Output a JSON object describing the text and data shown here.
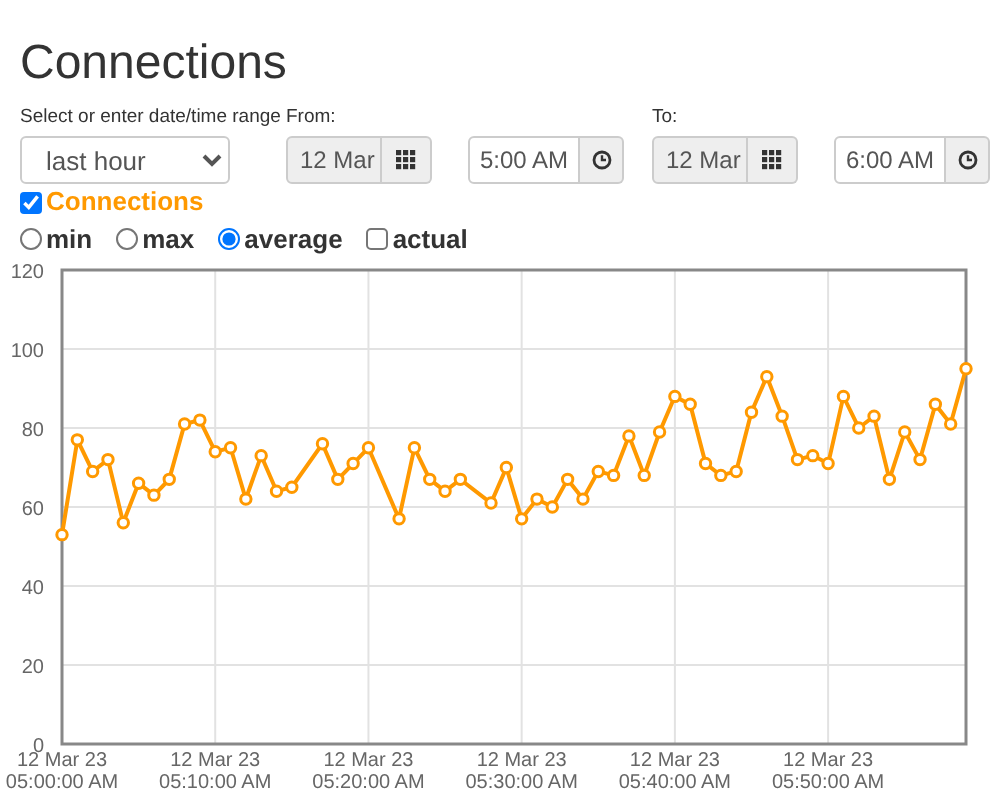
{
  "title": "Connections",
  "range": {
    "label": "Select or enter date/time range",
    "value": "last hour"
  },
  "from": {
    "label": "From:",
    "date": {
      "value": "12 Mar",
      "disabled": true
    },
    "time": {
      "value": "5:00 AM",
      "disabled": false
    }
  },
  "to": {
    "label": "To:",
    "date": {
      "value": "12 Mar",
      "disabled": true
    },
    "time": {
      "value": "6:00 AM",
      "disabled": false
    }
  },
  "series_toggle": {
    "checked": true
  },
  "modes": [
    {
      "kind": "radio",
      "label": "min",
      "selected": false
    },
    {
      "kind": "radio",
      "label": "max",
      "selected": false
    },
    {
      "kind": "radio",
      "label": "average",
      "selected": true
    },
    {
      "kind": "checkbox",
      "label": "actual",
      "checked": false
    }
  ],
  "chart_data": {
    "type": "line",
    "categories": [
      "12 Mar 23\n05:00:00 AM",
      null,
      null,
      null,
      null,
      null,
      null,
      null,
      null,
      null,
      "12 Mar 23\n05:10:00 AM",
      null,
      null,
      null,
      null,
      null,
      null,
      null,
      null,
      null,
      "12 Mar 23\n05:20:00 AM",
      null,
      null,
      null,
      null,
      null,
      null,
      null,
      null,
      null,
      "12 Mar 23\n05:30:00 AM",
      null,
      null,
      null,
      null,
      null,
      null,
      null,
      null,
      null,
      "12 Mar 23\n05:40:00 AM",
      null,
      null,
      null,
      null,
      null,
      null,
      null,
      null,
      null,
      "12 Mar 23\n05:50:00 AM",
      null,
      null,
      null,
      null,
      null,
      null,
      null,
      null,
      null
    ],
    "series": [
      {
        "name": "Connections",
        "color": "#ff9900",
        "marker": "circle",
        "values": [
          53,
          77,
          69,
          72,
          56,
          66,
          63,
          67,
          81,
          82,
          74,
          75,
          62,
          73,
          64,
          65,
          null,
          76,
          67,
          71,
          75,
          null,
          57,
          75,
          67,
          64,
          67,
          null,
          61,
          70,
          57,
          62,
          60,
          67,
          62,
          69,
          68,
          78,
          68,
          79,
          88,
          86,
          71,
          68,
          69,
          84,
          93,
          83,
          72,
          73,
          71,
          88,
          80,
          83,
          67,
          79,
          72,
          86,
          81,
          95
        ]
      }
    ],
    "grid": true,
    "ylim": [
      0,
      120
    ],
    "yticks": [
      0,
      20,
      40,
      60,
      80,
      100,
      120
    ]
  }
}
